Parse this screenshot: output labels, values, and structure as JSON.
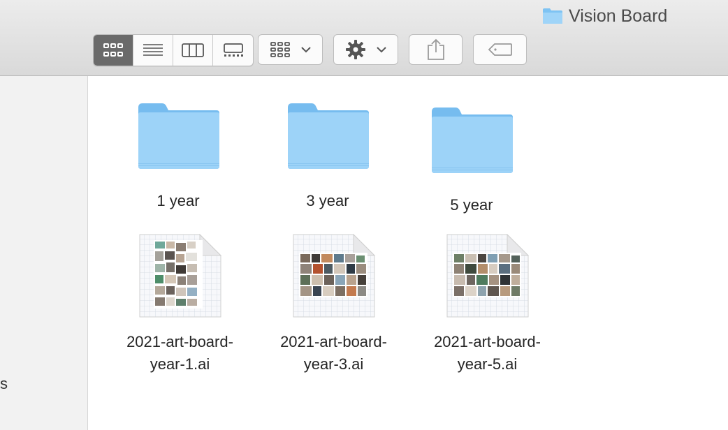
{
  "window": {
    "title": "Vision Board",
    "title_icon": "folder-icon"
  },
  "toolbar": {
    "view_modes": [
      {
        "name": "icon-view",
        "icon": "grid-icon",
        "active": true
      },
      {
        "name": "list-view",
        "icon": "list-icon",
        "active": false
      },
      {
        "name": "column-view",
        "icon": "columns-icon",
        "active": false
      },
      {
        "name": "gallery-view",
        "icon": "gallery-icon",
        "active": false
      }
    ],
    "group_button": {
      "icon": "grid-icon",
      "menu": "chevron-down-icon"
    },
    "action_button": {
      "icon": "gear-icon",
      "menu": "chevron-down-icon"
    },
    "share_button": {
      "icon": "share-icon"
    },
    "tags_button": {
      "icon": "tag-icon"
    }
  },
  "sidebar": {
    "fragment_text": "s"
  },
  "folders": [
    {
      "name": "1 year"
    },
    {
      "name": "3 year"
    },
    {
      "name": "5 year"
    }
  ],
  "files": [
    {
      "name_line1": "2021-art-board-",
      "name_line2": "year-1.ai"
    },
    {
      "name_line1": "2021-art-board-",
      "name_line2": "year-3.ai"
    },
    {
      "name_line1": "2021-art-board-",
      "name_line2": "year-5.ai"
    }
  ],
  "colors": {
    "folder_blue": "#8fcdf6",
    "active_segment": "#6a6a6a"
  }
}
